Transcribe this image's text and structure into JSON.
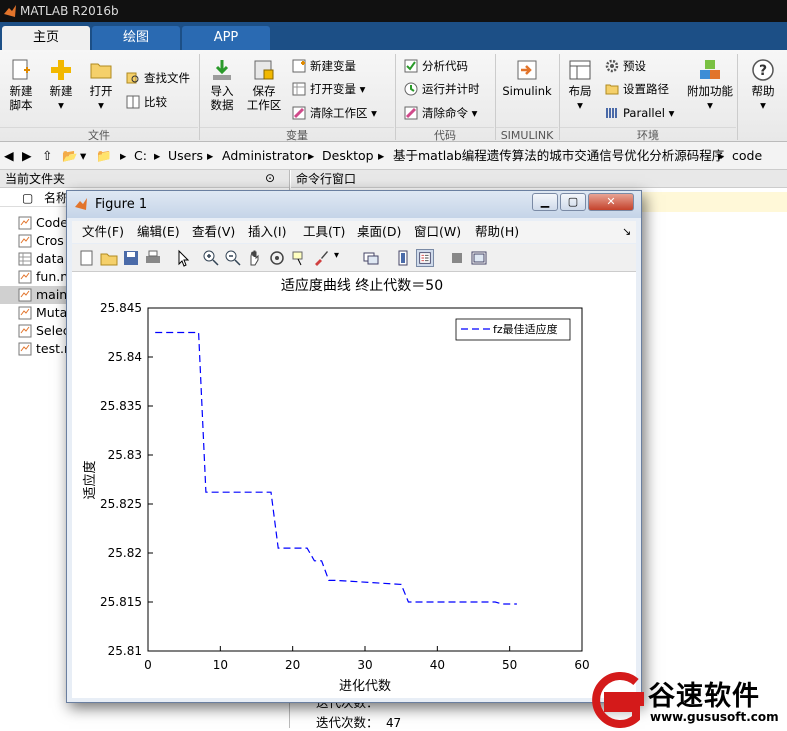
{
  "app": {
    "title": "MATLAB R2016b"
  },
  "tabs": [
    {
      "label": "主页"
    },
    {
      "label": "绘图"
    },
    {
      "label": "APP"
    }
  ],
  "ribbon": {
    "file": {
      "new_script": [
        "新建",
        "脚本"
      ],
      "new": "新建",
      "open": "打开",
      "find_files": "查找文件",
      "compare": "比较",
      "group": "文件"
    },
    "variable": {
      "import": [
        "导入",
        "数据"
      ],
      "save_ws": [
        "保存",
        "工作区"
      ],
      "new_var": "新建变量",
      "open_var": "打开变量",
      "clear_ws": "清除工作区",
      "group": "变量"
    },
    "code": {
      "analyze": "分析代码",
      "run_time": "运行并计时",
      "clear_cmd": "清除命令",
      "group": "代码"
    },
    "simulink": {
      "label": "Simulink",
      "group": "SIMULINK"
    },
    "env": {
      "layout": "布局",
      "prefs": "预设",
      "set_path": "设置路径",
      "parallel": "Parallel",
      "addons": "附加功能",
      "group": "环境"
    },
    "help": {
      "label": "帮助"
    }
  },
  "address": {
    "parts": [
      "C:",
      "Users",
      "Administrator",
      "Desktop",
      "基于matlab编程遗传算法的城市交通信号优化分析源码程序",
      "code"
    ]
  },
  "current_folder": {
    "title": "当前文件夹",
    "col_name": "名称",
    "files": [
      "Code",
      "Cros",
      "data",
      "fun.n",
      "main",
      "Muta",
      "Selec",
      "test.n"
    ]
  },
  "command_window": {
    "title": "命令行窗口",
    "lines": [
      "迭代次数：",
      "迭代次数：   47"
    ]
  },
  "figure": {
    "title": "Figure 1",
    "menu": [
      "文件(F)",
      "编辑(E)",
      "查看(V)",
      "插入(I)",
      "工具(T)",
      "桌面(D)",
      "窗口(W)",
      "帮助(H)"
    ]
  },
  "chart_data": {
    "type": "line",
    "title": "适应度曲线  终止代数＝50",
    "xlabel": "进化代数",
    "ylabel": "适应度",
    "xlim": [
      0,
      60
    ],
    "ylim": [
      25.81,
      25.845
    ],
    "xticks": [
      0,
      10,
      20,
      30,
      40,
      50,
      60
    ],
    "yticks": [
      25.81,
      25.815,
      25.82,
      25.825,
      25.83,
      25.835,
      25.84,
      25.845
    ],
    "legend_position": "top-right",
    "series": [
      {
        "name": "fz最佳适应度",
        "color": "#0000ff",
        "style": "dashed",
        "x": [
          1,
          7,
          8,
          17,
          18,
          22,
          23,
          24,
          25,
          26,
          35,
          36,
          47,
          48,
          49,
          50,
          51
        ],
        "y": [
          25.8425,
          25.8425,
          25.8262,
          25.8262,
          25.8205,
          25.8205,
          25.8192,
          25.8192,
          25.8172,
          25.8172,
          25.8168,
          25.815,
          25.815,
          25.815,
          25.8148,
          25.8148,
          25.8148
        ]
      }
    ]
  },
  "watermark": {
    "brand": "谷速软件",
    "url": "www.gususoft.com"
  },
  "colors": {
    "tab_bar": "#1c4f86",
    "series": "#0000ff"
  }
}
